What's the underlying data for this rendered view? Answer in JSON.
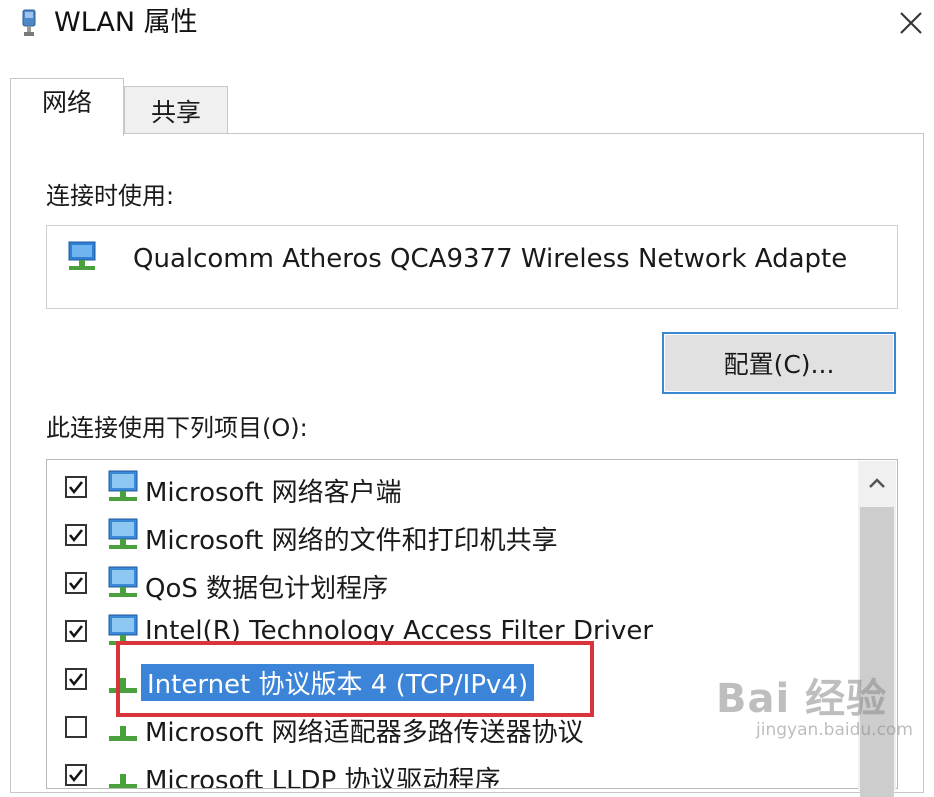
{
  "window": {
    "title": "WLAN 属性",
    "icon": "network-adapter-icon"
  },
  "tabs": [
    {
      "label": "网络",
      "active": true
    },
    {
      "label": "共享",
      "active": false
    }
  ],
  "connect_using": {
    "label": "连接时使用:",
    "adapter_name": "Qualcomm Atheros QCA9377 Wireless Network Adapte",
    "configure_button": "配置(C)..."
  },
  "items_section": {
    "label": "此连接使用下列项目(O):",
    "items": [
      {
        "label": "Microsoft 网络客户端",
        "checked": true,
        "icon": "network-client-icon"
      },
      {
        "label": "Microsoft 网络的文件和打印机共享",
        "checked": true,
        "icon": "network-client-icon"
      },
      {
        "label": "QoS 数据包计划程序",
        "checked": true,
        "icon": "network-client-icon"
      },
      {
        "label": "Intel(R) Technology Access Filter Driver",
        "checked": true,
        "icon": "network-client-icon"
      },
      {
        "label": "Internet 协议版本 4 (TCP/IPv4)",
        "checked": true,
        "selected": true,
        "icon": "protocol-icon"
      },
      {
        "label": "Microsoft 网络适配器多路传送器协议",
        "checked": false,
        "icon": "protocol-icon"
      },
      {
        "label": "Microsoft LLDP 协议驱动程序",
        "checked": true,
        "icon": "protocol-icon"
      }
    ]
  },
  "watermark": {
    "main": "Bai 经验",
    "sub": "jingyan.baidu.com"
  },
  "colors": {
    "selection": "#3b84d8",
    "highlight_border": "#d9333b",
    "button_border": "#3a88d1"
  }
}
